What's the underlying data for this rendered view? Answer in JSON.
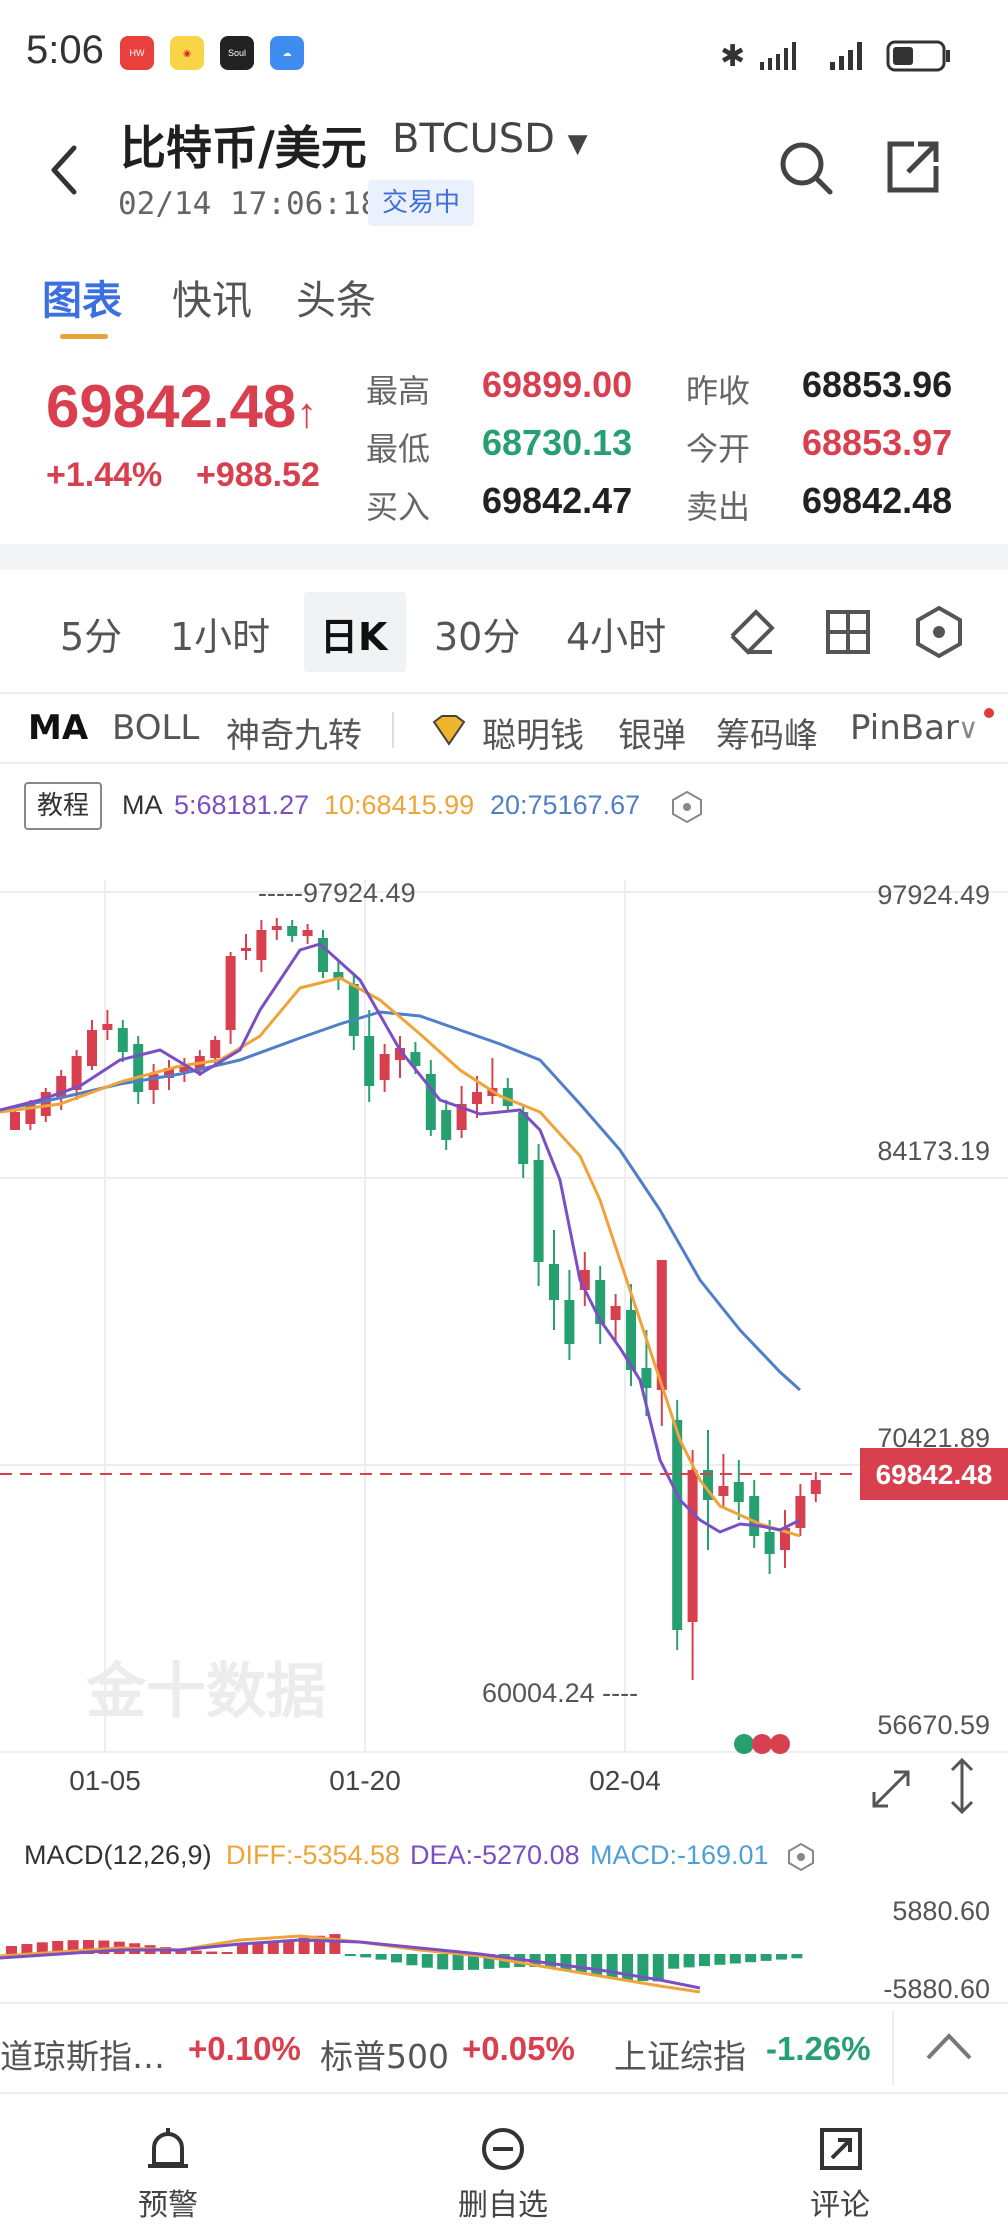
{
  "status_bar": {
    "time": "5:06",
    "apps": [
      "HUAWEI",
      "weibo",
      "Soul",
      "weather"
    ]
  },
  "header": {
    "title": "比特币/美元",
    "symbol": "BTCUSD",
    "timestamp": "02/14 17:06:18",
    "trading_badge": "交易中"
  },
  "tabs": [
    "图表",
    "快讯",
    "头条"
  ],
  "quote": {
    "price": "69842.48",
    "change_pct": "+1.44%",
    "change": "+988.52",
    "high_label": "最高",
    "high": "69899.00",
    "low_label": "最低",
    "low": "68730.13",
    "bid_label": "买入",
    "bid": "69842.47",
    "prev_close_label": "昨收",
    "prev_close": "68853.96",
    "open_label": "今开",
    "open": "68853.97",
    "ask_label": "卖出",
    "ask": "69842.48"
  },
  "periods": [
    "5分",
    "1小时",
    "日K",
    "30分",
    "4小时"
  ],
  "indicators": [
    "MA",
    "BOLL",
    "神奇九转",
    "聪明钱",
    "银弹",
    "筹码峰",
    "PinBar"
  ],
  "ma_legend": {
    "tutorial": "教程",
    "label": "MA",
    "ma5": "5:68181.27",
    "ma10": "10:68415.99",
    "ma20": "20:75167.67"
  },
  "colors": {
    "up": "#d8404f",
    "down": "#27a071",
    "ma5": "#7b4fc4",
    "ma10": "#efa43a",
    "ma20": "#4f7fc8",
    "accent": "#3a70e0"
  },
  "chart": {
    "y_labels": [
      "97924.49",
      "84173.19",
      "70421.89",
      "56670.59"
    ],
    "max_label": "97924.49",
    "min_label": "60004.24",
    "current_price_tag": "69842.48",
    "x_labels": [
      "01-05",
      "01-20",
      "02-04"
    ],
    "watermark": "金十数据"
  },
  "chart_data": {
    "type": "candlestick",
    "ylim": [
      56670.59,
      97924.49
    ],
    "x": [
      "01-05",
      "01-20",
      "02-04"
    ],
    "high_marker": 97924.49,
    "low_marker": 60004.24,
    "last_price": 69842.48
  },
  "macd": {
    "label": "MACD(12,26,9)",
    "diff": "DIFF:-5354.58",
    "dea": "DEA:-5270.08",
    "macd": "MACD:-169.01",
    "y_top": "5880.60",
    "y_bottom": "-5880.60"
  },
  "ticker": [
    {
      "name": "道琼斯指…",
      "value": "+0.10%"
    },
    {
      "name": "标普500",
      "value": "+0.05%"
    },
    {
      "name": "上证综指",
      "value": "-1.26%"
    }
  ],
  "bottom_nav": [
    "预警",
    "删自选",
    "评论"
  ]
}
